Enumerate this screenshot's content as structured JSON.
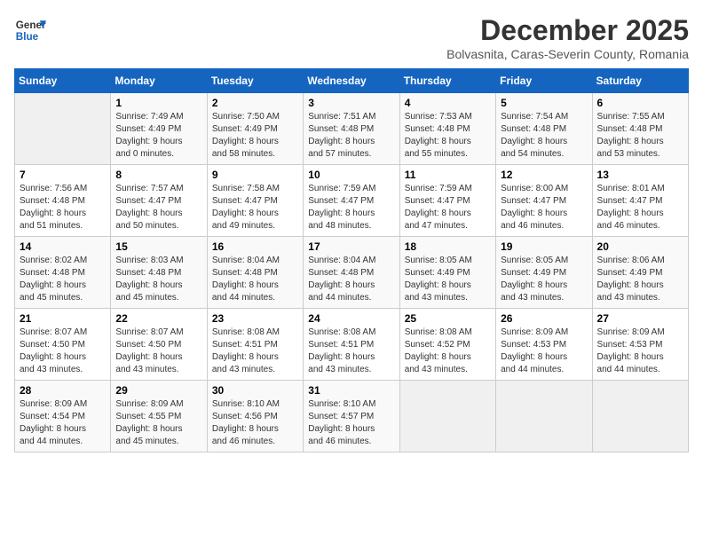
{
  "header": {
    "logo_line1": "General",
    "logo_line2": "Blue",
    "title": "December 2025",
    "subtitle": "Bolvasnita, Caras-Severin County, Romania"
  },
  "weekdays": [
    "Sunday",
    "Monday",
    "Tuesday",
    "Wednesday",
    "Thursday",
    "Friday",
    "Saturday"
  ],
  "weeks": [
    [
      {
        "day": "",
        "info": ""
      },
      {
        "day": "1",
        "info": "Sunrise: 7:49 AM\nSunset: 4:49 PM\nDaylight: 9 hours\nand 0 minutes."
      },
      {
        "day": "2",
        "info": "Sunrise: 7:50 AM\nSunset: 4:49 PM\nDaylight: 8 hours\nand 58 minutes."
      },
      {
        "day": "3",
        "info": "Sunrise: 7:51 AM\nSunset: 4:48 PM\nDaylight: 8 hours\nand 57 minutes."
      },
      {
        "day": "4",
        "info": "Sunrise: 7:53 AM\nSunset: 4:48 PM\nDaylight: 8 hours\nand 55 minutes."
      },
      {
        "day": "5",
        "info": "Sunrise: 7:54 AM\nSunset: 4:48 PM\nDaylight: 8 hours\nand 54 minutes."
      },
      {
        "day": "6",
        "info": "Sunrise: 7:55 AM\nSunset: 4:48 PM\nDaylight: 8 hours\nand 53 minutes."
      }
    ],
    [
      {
        "day": "7",
        "info": "Sunrise: 7:56 AM\nSunset: 4:48 PM\nDaylight: 8 hours\nand 51 minutes."
      },
      {
        "day": "8",
        "info": "Sunrise: 7:57 AM\nSunset: 4:47 PM\nDaylight: 8 hours\nand 50 minutes."
      },
      {
        "day": "9",
        "info": "Sunrise: 7:58 AM\nSunset: 4:47 PM\nDaylight: 8 hours\nand 49 minutes."
      },
      {
        "day": "10",
        "info": "Sunrise: 7:59 AM\nSunset: 4:47 PM\nDaylight: 8 hours\nand 48 minutes."
      },
      {
        "day": "11",
        "info": "Sunrise: 7:59 AM\nSunset: 4:47 PM\nDaylight: 8 hours\nand 47 minutes."
      },
      {
        "day": "12",
        "info": "Sunrise: 8:00 AM\nSunset: 4:47 PM\nDaylight: 8 hours\nand 46 minutes."
      },
      {
        "day": "13",
        "info": "Sunrise: 8:01 AM\nSunset: 4:47 PM\nDaylight: 8 hours\nand 46 minutes."
      }
    ],
    [
      {
        "day": "14",
        "info": "Sunrise: 8:02 AM\nSunset: 4:48 PM\nDaylight: 8 hours\nand 45 minutes."
      },
      {
        "day": "15",
        "info": "Sunrise: 8:03 AM\nSunset: 4:48 PM\nDaylight: 8 hours\nand 45 minutes."
      },
      {
        "day": "16",
        "info": "Sunrise: 8:04 AM\nSunset: 4:48 PM\nDaylight: 8 hours\nand 44 minutes."
      },
      {
        "day": "17",
        "info": "Sunrise: 8:04 AM\nSunset: 4:48 PM\nDaylight: 8 hours\nand 44 minutes."
      },
      {
        "day": "18",
        "info": "Sunrise: 8:05 AM\nSunset: 4:49 PM\nDaylight: 8 hours\nand 43 minutes."
      },
      {
        "day": "19",
        "info": "Sunrise: 8:05 AM\nSunset: 4:49 PM\nDaylight: 8 hours\nand 43 minutes."
      },
      {
        "day": "20",
        "info": "Sunrise: 8:06 AM\nSunset: 4:49 PM\nDaylight: 8 hours\nand 43 minutes."
      }
    ],
    [
      {
        "day": "21",
        "info": "Sunrise: 8:07 AM\nSunset: 4:50 PM\nDaylight: 8 hours\nand 43 minutes."
      },
      {
        "day": "22",
        "info": "Sunrise: 8:07 AM\nSunset: 4:50 PM\nDaylight: 8 hours\nand 43 minutes."
      },
      {
        "day": "23",
        "info": "Sunrise: 8:08 AM\nSunset: 4:51 PM\nDaylight: 8 hours\nand 43 minutes."
      },
      {
        "day": "24",
        "info": "Sunrise: 8:08 AM\nSunset: 4:51 PM\nDaylight: 8 hours\nand 43 minutes."
      },
      {
        "day": "25",
        "info": "Sunrise: 8:08 AM\nSunset: 4:52 PM\nDaylight: 8 hours\nand 43 minutes."
      },
      {
        "day": "26",
        "info": "Sunrise: 8:09 AM\nSunset: 4:53 PM\nDaylight: 8 hours\nand 44 minutes."
      },
      {
        "day": "27",
        "info": "Sunrise: 8:09 AM\nSunset: 4:53 PM\nDaylight: 8 hours\nand 44 minutes."
      }
    ],
    [
      {
        "day": "28",
        "info": "Sunrise: 8:09 AM\nSunset: 4:54 PM\nDaylight: 8 hours\nand 44 minutes."
      },
      {
        "day": "29",
        "info": "Sunrise: 8:09 AM\nSunset: 4:55 PM\nDaylight: 8 hours\nand 45 minutes."
      },
      {
        "day": "30",
        "info": "Sunrise: 8:10 AM\nSunset: 4:56 PM\nDaylight: 8 hours\nand 46 minutes."
      },
      {
        "day": "31",
        "info": "Sunrise: 8:10 AM\nSunset: 4:57 PM\nDaylight: 8 hours\nand 46 minutes."
      },
      {
        "day": "",
        "info": ""
      },
      {
        "day": "",
        "info": ""
      },
      {
        "day": "",
        "info": ""
      }
    ]
  ]
}
